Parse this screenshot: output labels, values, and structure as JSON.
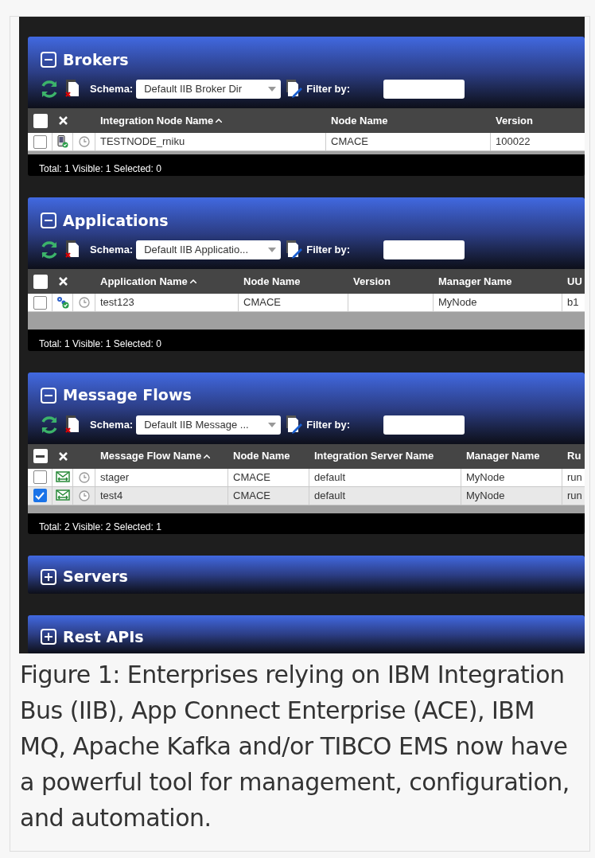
{
  "panels": [
    {
      "title": "Brokers",
      "expanded": true,
      "schema_label": "Schema:",
      "schema": "Default IIB Broker Dir",
      "filter_label": "Filter by:",
      "header_partial": false,
      "columns": [
        {
          "label": "Integration Node Name",
          "sorted": true
        },
        {
          "label": "Node Name",
          "sorted": false
        },
        {
          "label": "Version",
          "sorted": false
        }
      ],
      "rows": [
        {
          "kind": "broker",
          "checked": false,
          "cells": [
            "TESTNODE_rniku",
            "CMACE",
            "100022"
          ]
        }
      ],
      "footer": "Total: 1 Visible: 1 Selected: 0"
    },
    {
      "title": "Applications",
      "expanded": true,
      "schema_label": "Schema:",
      "schema": "Default IIB Applicatio...",
      "filter_label": "Filter by:",
      "header_partial": false,
      "columns": [
        {
          "label": "Application Name",
          "sorted": true
        },
        {
          "label": "Node Name",
          "sorted": false
        },
        {
          "label": "Version",
          "sorted": false
        },
        {
          "label": "Manager Name",
          "sorted": false
        },
        {
          "label": "UU",
          "sorted": false
        }
      ],
      "rows": [
        {
          "kind": "application",
          "checked": false,
          "cells": [
            "test123",
            "CMACE",
            "",
            "MyNode",
            "b1"
          ]
        }
      ],
      "footer": "Total: 1 Visible: 1 Selected: 0"
    },
    {
      "title": "Message Flows",
      "expanded": true,
      "schema_label": "Schema:",
      "schema": "Default IIB Message ...",
      "filter_label": "Filter by:",
      "header_partial": true,
      "columns": [
        {
          "label": "Message Flow Name",
          "sorted": true
        },
        {
          "label": "Node Name",
          "sorted": false
        },
        {
          "label": "Integration Server Name",
          "sorted": false
        },
        {
          "label": "Manager Name",
          "sorted": false
        },
        {
          "label": "Ru",
          "sorted": false
        }
      ],
      "rows": [
        {
          "kind": "flow",
          "checked": false,
          "cells": [
            "stager",
            "CMACE",
            "default",
            "MyNode",
            "run"
          ]
        },
        {
          "kind": "flow",
          "checked": true,
          "cells": [
            "test4",
            "CMACE",
            "default",
            "MyNode",
            "run"
          ]
        }
      ],
      "footer": "Total: 2 Visible: 2 Selected: 1"
    },
    {
      "title": "Servers",
      "expanded": false
    },
    {
      "title": "Rest APIs",
      "expanded": false
    }
  ],
  "caption": "Figure 1: Enterprises relying on IBM Integration Bus (IIB), App Connect Enterprise (ACE), IBM MQ, Apache Kafka and/or TIBCO EMS now have a powerful tool for management, configuration, and automation."
}
